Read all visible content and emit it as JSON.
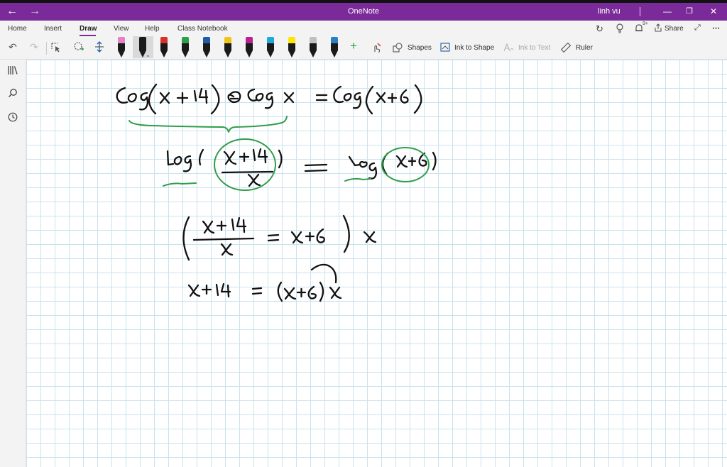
{
  "titlebar": {
    "app_title": "OneNote",
    "user_name": "linh vu"
  },
  "tabs": [
    {
      "label": "Home"
    },
    {
      "label": "Insert"
    },
    {
      "label": "Draw"
    },
    {
      "label": "View"
    },
    {
      "label": "Help"
    },
    {
      "label": "Class Notebook"
    }
  ],
  "ribbon_right": {
    "share_label": "Share",
    "notifications_count": "9+"
  },
  "toolbar": {
    "shapes_label": "Shapes",
    "ink_to_shape_label": "Ink to Shape",
    "ink_to_text_label": "Ink to Text",
    "ruler_label": "Ruler"
  },
  "pens": [
    {
      "color": "#e87fc8"
    },
    {
      "color": "#1a1a1a"
    },
    {
      "color": "#d9302c"
    },
    {
      "color": "#2e9e4a"
    },
    {
      "color": "#1f5ba8"
    },
    {
      "color": "#f2c417"
    },
    {
      "color": "#b8218f"
    },
    {
      "color": "#1fa9d8"
    },
    {
      "color": "#ffe600"
    },
    {
      "color": "#c0c0c0"
    },
    {
      "color": "#2a7fc4"
    }
  ],
  "colors": {
    "accent": "#7b2a9a",
    "ink_black": "#111111",
    "ink_green": "#2e9e4a",
    "grid": "#c9e3ee"
  }
}
